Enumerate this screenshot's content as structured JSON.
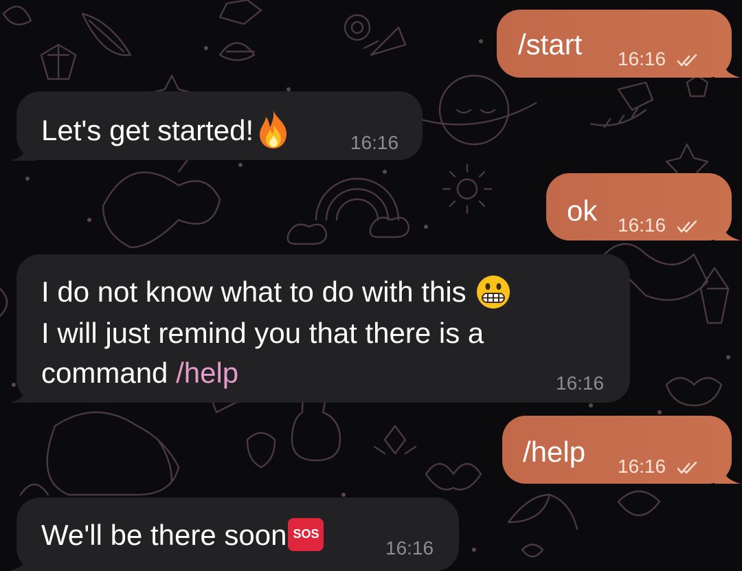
{
  "chat": {
    "messages": [
      {
        "direction": "outgoing",
        "text": "/start",
        "time": "16:16",
        "status": "read-double-check-icon"
      },
      {
        "direction": "incoming",
        "text": "Let's get started!",
        "emoji": "fire-emoji",
        "time": "16:16"
      },
      {
        "direction": "outgoing",
        "text": "ok",
        "time": "16:16",
        "status": "read-double-check-icon"
      },
      {
        "direction": "incoming",
        "lines": [
          "I do not know what to do with this",
          "I will just remind you that there is a",
          "command "
        ],
        "emoji": "grimacing-face-emoji",
        "command": "/help",
        "time": "16:16"
      },
      {
        "direction": "outgoing",
        "text": "/help",
        "time": "16:16",
        "status": "read-double-check-icon"
      },
      {
        "direction": "incoming",
        "text": "We'll be there soon",
        "emoji_label": "SOS",
        "time": "16:16"
      }
    ]
  },
  "colors": {
    "background": "#0b0a0c",
    "incoming_bubble": "#222124",
    "outgoing_bubble": "#c5704f",
    "command_link": "#e59ccb",
    "doodle_lines": "#4a3a3f"
  }
}
